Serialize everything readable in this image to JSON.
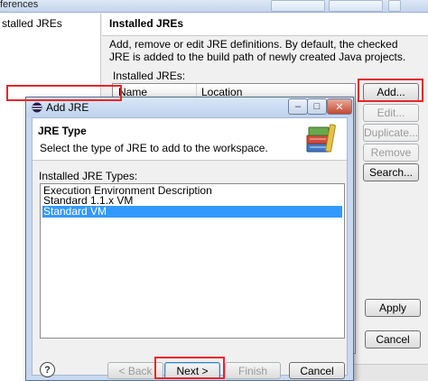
{
  "preferences": {
    "title_fragment": "ferences",
    "tree_item": "stalled JREs",
    "page_title": "Installed JREs",
    "description": "Add, remove or edit JRE definitions. By default, the checked JRE is added to the build path of newly created Java projects.",
    "installed_label": "Installed JREs:",
    "columns": [
      "Name",
      "Location"
    ],
    "buttons": {
      "add": "Add...",
      "edit": "Edit...",
      "duplicate": "Duplicate...",
      "remove": "Remove",
      "search": "Search...",
      "apply": "Apply",
      "cancel": "Cancel"
    }
  },
  "dialog": {
    "title": "Add JRE",
    "page_title": "JRE Type",
    "page_desc": "Select the type of JRE to add to the workspace.",
    "types_label": "Installed JRE Types:",
    "types": [
      "Execution Environment Description",
      "Standard 1.1.x VM",
      "Standard VM"
    ],
    "selected_index": 2,
    "help": "?",
    "buttons": {
      "back": "< Back",
      "next": "Next >",
      "finish": "Finish",
      "cancel": "Cancel"
    }
  },
  "colors": {
    "selection": "#3399ff",
    "highlight": "#e8262a"
  }
}
